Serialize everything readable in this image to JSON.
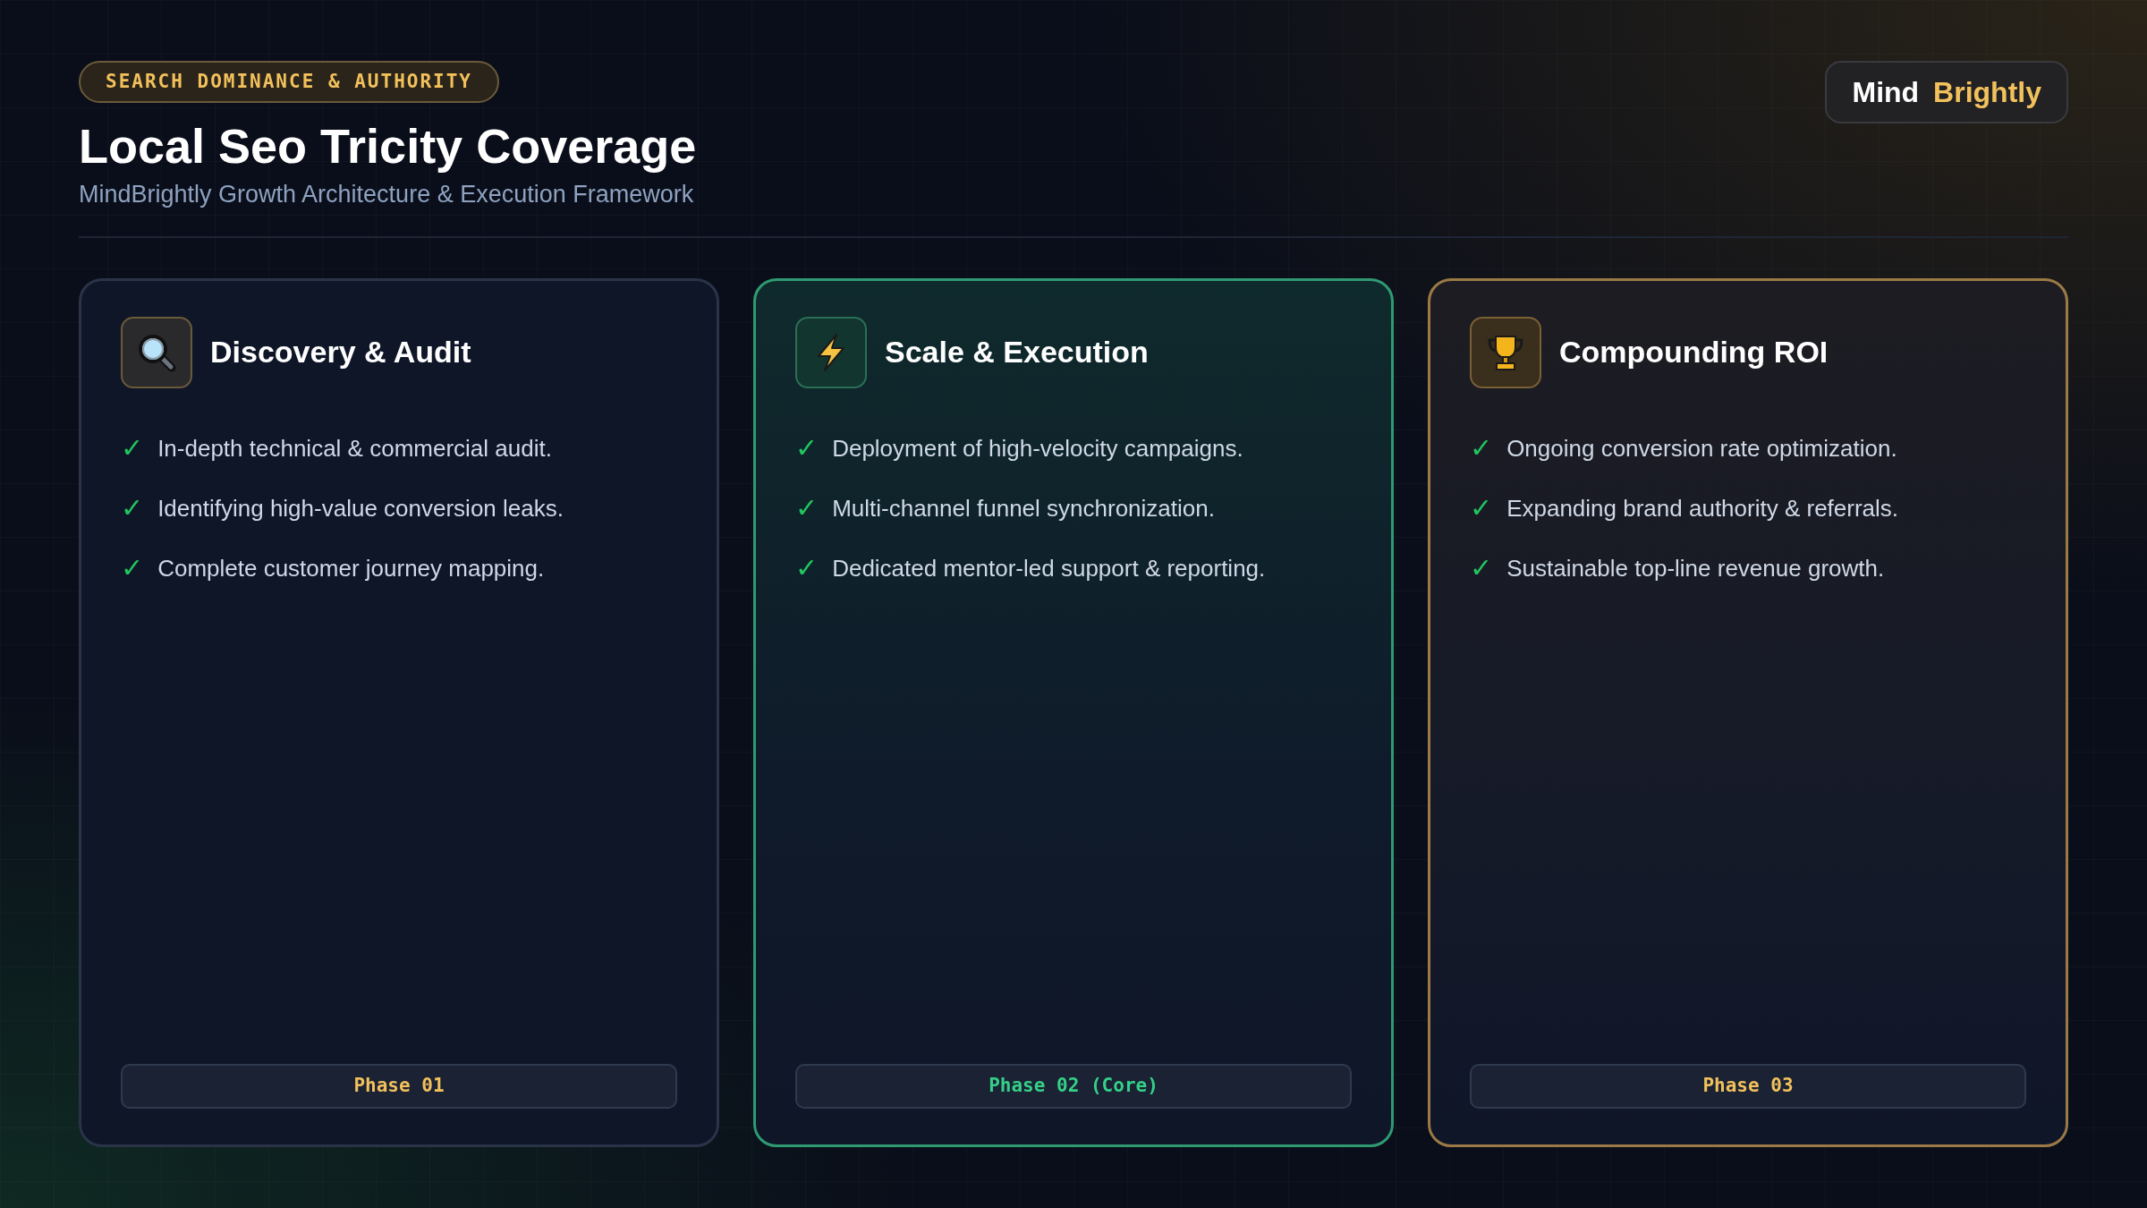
{
  "header": {
    "badge": "SEARCH DOMINANCE & AUTHORITY",
    "title": "Local Seo Tricity Coverage",
    "subtitle": "MindBrightly Growth Architecture & Execution Framework"
  },
  "logo": {
    "first": "Mind",
    "second": "Brightly"
  },
  "cards": [
    {
      "kind": "audit",
      "title": "Discovery & Audit",
      "check": "✓",
      "points": [
        "In-depth technical & commercial audit.",
        "Identifying high-value conversion leaks.",
        "Complete customer journey mapping."
      ],
      "phase": "Phase 01"
    },
    {
      "kind": "scale",
      "title": "Scale & Execution",
      "check": "✓",
      "points": [
        "Deployment of high-velocity campaigns.",
        "Multi-channel funnel synchronization.",
        "Dedicated mentor-led support & reporting."
      ],
      "phase": "Phase 02 (Core)"
    },
    {
      "kind": "roi",
      "title": "Compounding ROI",
      "check": "✓",
      "points": [
        "Ongoing conversion rate optimization.",
        "Expanding brand authority & referrals.",
        "Sustainable top-line revenue growth."
      ],
      "phase": "Phase 03"
    }
  ]
}
